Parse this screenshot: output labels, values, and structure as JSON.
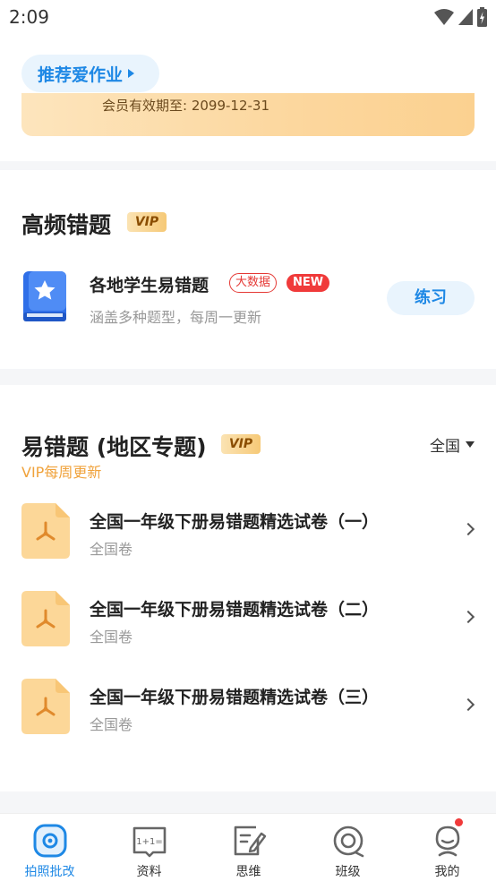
{
  "status_bar": {
    "time": "2:09"
  },
  "recommend": {
    "label": "推荐爱作业"
  },
  "vip_banner": {
    "expiry": "会员有效期至: 2099-12-31"
  },
  "high_freq": {
    "title": "高频错题",
    "vip_badge": "VIP",
    "item": {
      "title": "各地学生易错题",
      "tag_bigdata": "大数据",
      "tag_new": "NEW",
      "subtitle": "涵盖多种题型，每周一更新",
      "action": "练习"
    }
  },
  "regional": {
    "title": "易错题 (地区专题)",
    "vip_badge": "VIP",
    "note": "VIP每周更新",
    "filter": "全国",
    "papers": [
      {
        "title": "全国一年级下册易错题精选试卷（一）",
        "subtitle": "全国卷"
      },
      {
        "title": "全国一年级下册易错题精选试卷（二）",
        "subtitle": "全国卷"
      },
      {
        "title": "全国一年级下册易错题精选试卷（三）",
        "subtitle": "全国卷"
      }
    ]
  },
  "tabs": [
    {
      "label": "拍照批改",
      "icon": "camera-check-icon",
      "active": true
    },
    {
      "label": "资料",
      "icon": "book-math-icon",
      "active": false
    },
    {
      "label": "思维",
      "icon": "pen-note-icon",
      "active": false
    },
    {
      "label": "班级",
      "icon": "class-target-icon",
      "active": false
    },
    {
      "label": "我的",
      "icon": "profile-avatar-icon",
      "active": false
    }
  ],
  "colors": {
    "accent": "#1e88e5",
    "vip_gold": "#f0a23b",
    "alert_red": "#f03a3a"
  }
}
